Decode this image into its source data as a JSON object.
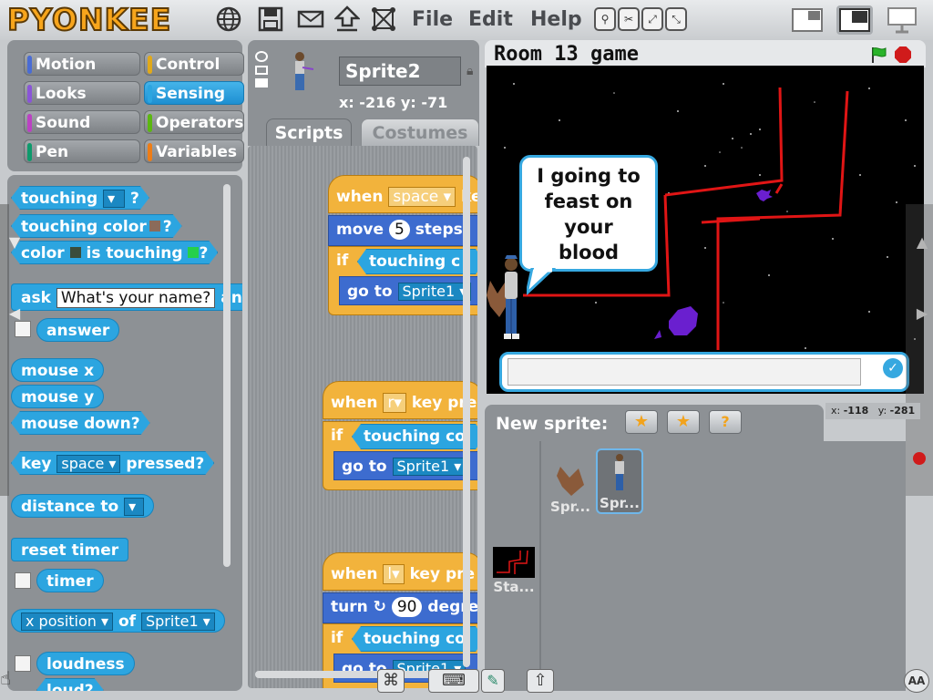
{
  "app": {
    "logo": "PYONKEE"
  },
  "menu": {
    "file": "File",
    "edit": "Edit",
    "help": "Help"
  },
  "categories": [
    {
      "label": "Motion",
      "color": "#4a6cd4"
    },
    {
      "label": "Control",
      "color": "#e1a91a"
    },
    {
      "label": "Looks",
      "color": "#8a55d7"
    },
    {
      "label": "Sensing",
      "color": "#2ca5e0",
      "selected": true
    },
    {
      "label": "Sound",
      "color": "#bb42c3"
    },
    {
      "label": "Operators",
      "color": "#5cb712"
    },
    {
      "label": "Pen",
      "color": "#0e9a6c"
    },
    {
      "label": "Variables",
      "color": "#ee7d16"
    }
  ],
  "palette": {
    "touching": "touching",
    "touching_q": "?",
    "touching_color": "touching color",
    "color": "color",
    "is_touching": "is touching",
    "ask": "ask",
    "ask_default": "What's your name?",
    "ask_and_wait": "an",
    "answer": "answer",
    "mouse_x": "mouse x",
    "mouse_y": "mouse y",
    "mouse_down": "mouse down?",
    "key": "key",
    "key_value": "space",
    "pressed": "pressed?",
    "distance_to": "distance to",
    "reset_timer": "reset timer",
    "timer": "timer",
    "x_position": "x position",
    "of": "of",
    "of_sprite": "Sprite1",
    "loudness": "loudness",
    "loud": "loud?"
  },
  "sprite_info": {
    "name": "Sprite2",
    "x_label": "x:",
    "x": "-216",
    "y_label": "y:",
    "y": "-71"
  },
  "tabs": {
    "scripts": "Scripts",
    "costumes": "Costumes"
  },
  "scripts": {
    "s1": {
      "when": "when",
      "key": "space",
      "key_suffix": "ke",
      "move": "move",
      "steps_value": "5",
      "steps": "steps",
      "if": "if",
      "touching": "touching",
      "touching_rest": "c",
      "goto": "go to",
      "goto_target": "Sprite1"
    },
    "s2": {
      "when": "when",
      "key": "r",
      "key_suffix": "key pre",
      "if": "if",
      "touching": "touching col",
      "goto": "go to",
      "goto_target": "Sprite1"
    },
    "s3": {
      "when": "when",
      "key": "l",
      "key_suffix": "key pre",
      "turn": "turn",
      "turn_value": "90",
      "degrees": "degre",
      "if": "if",
      "touching": "touching col",
      "goto": "go to",
      "goto_target": "Sprite1"
    }
  },
  "stage": {
    "title": "Room 13 game",
    "speech": [
      "I going to",
      "feast on",
      "your",
      "blood"
    ],
    "answer_value": "",
    "mouse_x_label": "x:",
    "mouse_x": "-118",
    "mouse_y_label": "y:",
    "mouse_y": "-281"
  },
  "new_sprite": {
    "label": "New sprite:"
  },
  "sprites": [
    {
      "name": "Spr..."
    },
    {
      "name": "Spr...",
      "selected": true
    }
  ],
  "stage_thumb": {
    "name": "Sta..."
  },
  "colors": {
    "accent": "#2ca5e0",
    "events": "#f2b33c",
    "motion": "#3d6ccf",
    "lines": "#e01515"
  }
}
